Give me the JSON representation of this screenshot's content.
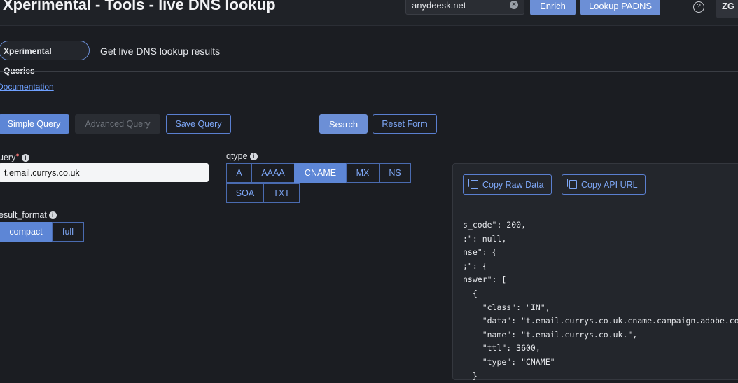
{
  "header": {
    "title": "Xperimental - Tools - live DNS lookup",
    "search_value": "anydeesk.net",
    "enrich_label": "Enrich",
    "lookup_label": "Lookup PADNS",
    "help_icon": "question-circle-icon",
    "avatar_initials": "ZG"
  },
  "intro": {
    "tag": "Xperimental Queries",
    "subtitle": "Get live DNS lookup results",
    "doc_link": "Documentation"
  },
  "toolbar": {
    "simple_query": "Simple Query",
    "advanced_query": "Advanced Query",
    "save_query": "Save Query",
    "search": "Search",
    "reset_form": "Reset Form"
  },
  "form": {
    "query_label": "uery",
    "query_value": "t.email.currys.co.uk",
    "qtype_label": "qtype",
    "qtype_options": [
      "A",
      "AAAA",
      "CNAME",
      "MX",
      "NS",
      "SOA",
      "TXT"
    ],
    "qtype_selected": "CNAME",
    "result_format_label": "esult_format",
    "result_format_options": [
      "compact",
      "full"
    ],
    "result_format_selected": "compact"
  },
  "result": {
    "copy_raw": "Copy Raw Data",
    "copy_api": "Copy API URL",
    "json_lines": [
      "s_code\": 200,",
      ":\": null,",
      "nse\": {",
      ";\": {",
      "nswer\": [",
      "{",
      "  \"class\": \"IN\",",
      "  \"data\": \"t.email.currys.co.uk.cname.campaign.adobe.com.\",",
      "  \"name\": \"t.email.currys.co.uk.\",",
      "  \"ttl\": 3600,",
      "  \"type\": \"CNAME\"",
      "}"
    ]
  },
  "colors": {
    "background": "#1b1d22",
    "accent": "#6c8fd6",
    "link": "#6ea0ff"
  }
}
